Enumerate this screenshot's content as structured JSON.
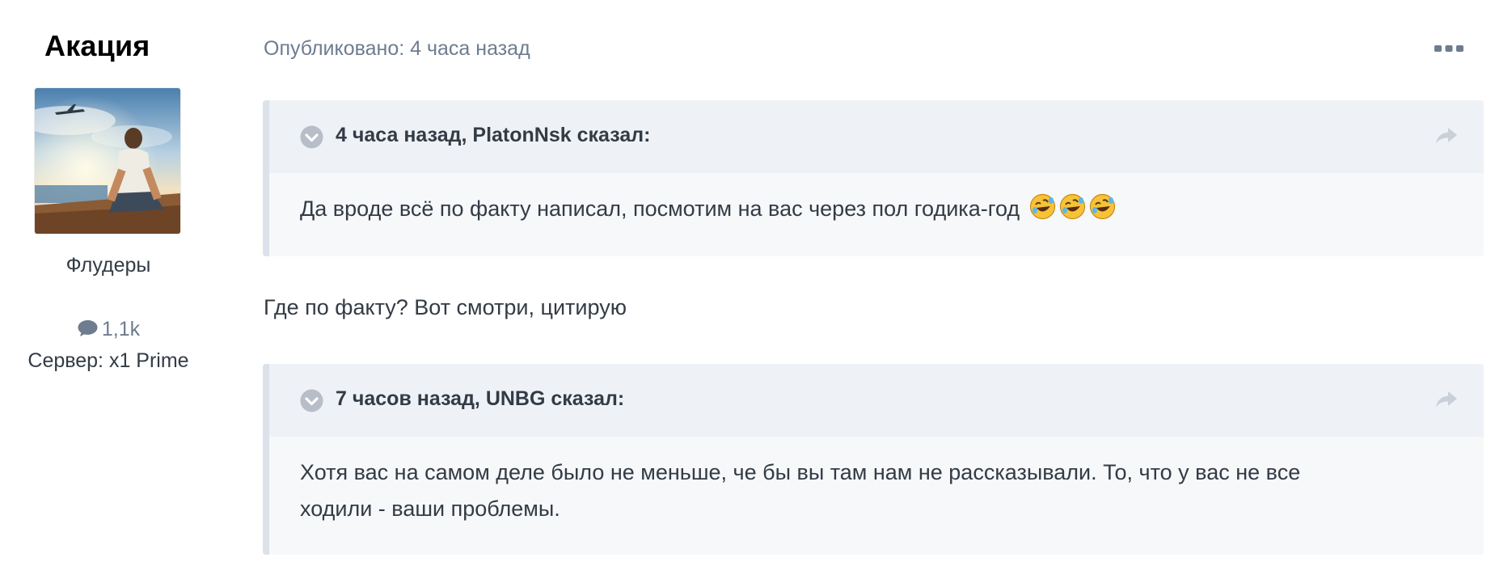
{
  "author": {
    "name": "Акация",
    "group": "Флудеры",
    "posts_count": "1,1k",
    "server": "Сервер: x1 Prime"
  },
  "post": {
    "meta": "Опубликовано: 4 часа назад",
    "more_icon": "ellipsis-icon",
    "quotes": [
      {
        "cite": "4 часа назад, PlatonNsk сказал:",
        "text": "Да вроде всё по факту написал, посмотим на вас через пол годика-год",
        "emojis": [
          "rofl-emoji",
          "rofl-emoji",
          "rofl-emoji"
        ]
      },
      {
        "cite": "7 часов назад, UNBG сказал:",
        "text_line1": "Хотя вас на самом деле было не меньше, че бы вы там нам не рассказывали. То, что у вас не все",
        "text_line2": "ходили - ваши проблемы."
      }
    ],
    "reply": "Где по факту? Вот смотри, цитирую"
  },
  "colors": {
    "quote_bg": "#f6f8fa",
    "quote_head_bg": "#eef2f6",
    "quote_border": "#dbe2ea",
    "meta_text": "#6e7c90",
    "body_text": "#333b45"
  }
}
